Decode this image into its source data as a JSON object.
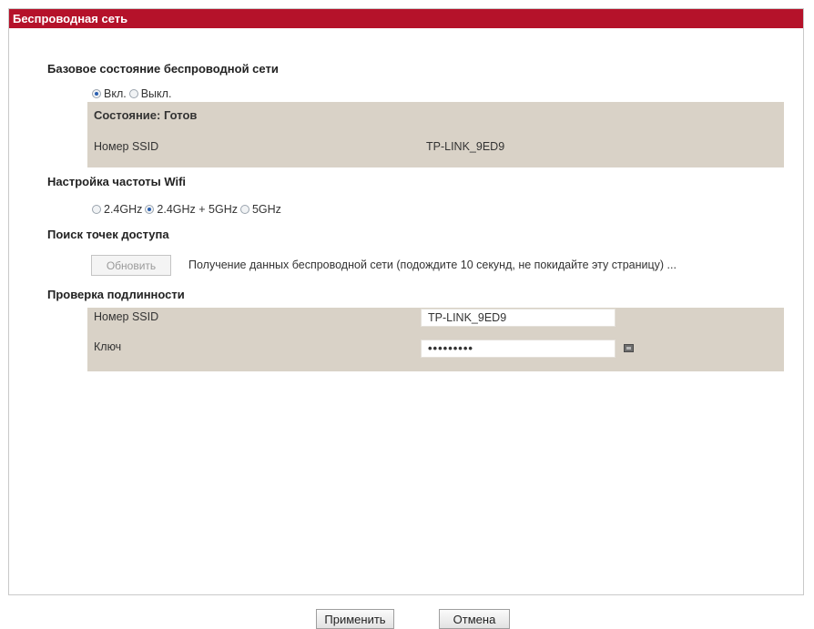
{
  "panel": {
    "title": "Беспроводная сеть"
  },
  "basic": {
    "heading": "Базовое состояние беспроводной сети",
    "on_label": "Вкл.",
    "off_label": "Выкл.",
    "selected": "on",
    "status": "Состояние: Готов",
    "ssid_label": "Номер SSID",
    "ssid_value": "TP-LINK_9ED9"
  },
  "freq": {
    "heading": "Настройка частоты Wifi",
    "options": [
      "2.4GHz",
      "2.4GHz + 5GHz",
      "5GHz"
    ],
    "selected": "2.4GHz + 5GHz"
  },
  "scan": {
    "heading": "Поиск точек доступа",
    "refresh_label": "Обновить",
    "info": "Получение данных беспроводной сети (подождите 10 секунд, не покидайте эту страницу) ..."
  },
  "auth": {
    "heading": "Проверка подлинности",
    "ssid_label": "Номер SSID",
    "ssid_value": "TP-LINK_9ED9",
    "key_label": "Ключ",
    "key_value": "•••••••••"
  },
  "footer": {
    "apply_label": "Применить",
    "cancel_label": "Отмена"
  },
  "colors": {
    "title_bar": "#b5122a",
    "box_bg": "#d9d2c7"
  },
  "icons": {
    "key_toggle": "eye-icon"
  }
}
